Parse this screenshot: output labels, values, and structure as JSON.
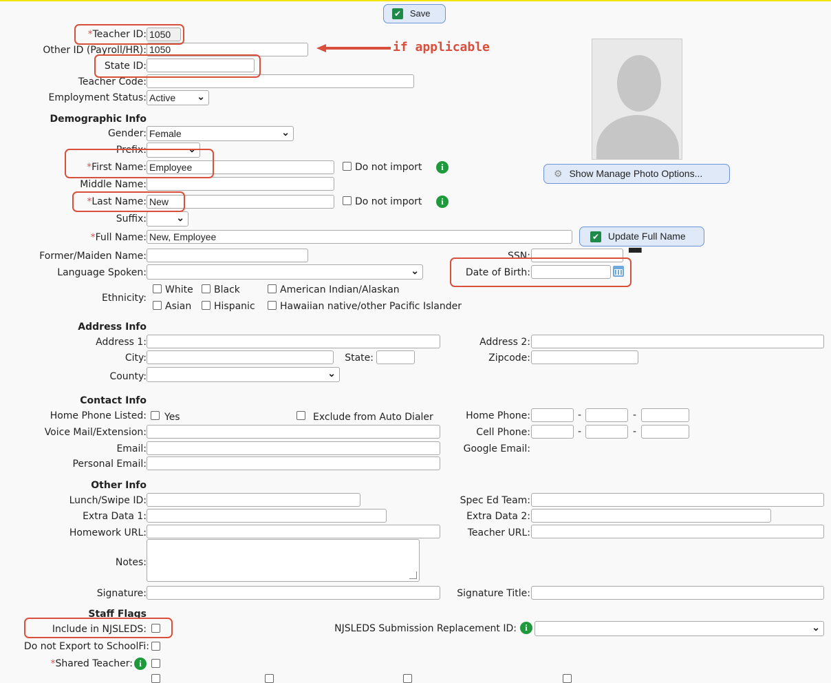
{
  "toolbar": {
    "save_label": "Save"
  },
  "annotation": {
    "note": "if applicable"
  },
  "fields": {
    "teacher_id": {
      "label": "Teacher ID:",
      "value": "1050"
    },
    "other_id": {
      "label": "Other ID (Payroll/HR):",
      "value": "1050"
    },
    "state_id": {
      "label": "State ID:",
      "value": ""
    },
    "teacher_code": {
      "label": "Teacher Code:",
      "value": ""
    },
    "employment_status": {
      "label": "Employment Status:",
      "value": "Active"
    }
  },
  "demographic": {
    "title": "Demographic Info",
    "gender": {
      "label": "Gender:",
      "value": "Female"
    },
    "prefix": {
      "label": "Prefix:",
      "value": ""
    },
    "first_name": {
      "label": "First Name:",
      "value": "Employee"
    },
    "middle_name": {
      "label": "Middle Name:",
      "value": ""
    },
    "last_name": {
      "label": "Last Name:",
      "value": "New"
    },
    "suffix": {
      "label": "Suffix:",
      "value": ""
    },
    "full_name": {
      "label": "Full Name:",
      "value": "New, Employee"
    },
    "former_name": {
      "label": "Former/Maiden Name:",
      "value": ""
    },
    "language": {
      "label": "Language Spoken:",
      "value": ""
    },
    "ssn": {
      "label": "SSN:",
      "value": ""
    },
    "dob": {
      "label": "Date of Birth:",
      "value": ""
    },
    "ethnicity": {
      "label": "Ethnicity:",
      "options": [
        "White",
        "Black",
        "American Indian/Alaskan",
        "Asian",
        "Hispanic",
        "Hawaiian native/other Pacific Islander"
      ]
    },
    "do_not_import": "Do not import",
    "update_full_name": "Update Full Name",
    "show_photo_options": "Show Manage Photo Options..."
  },
  "address": {
    "title": "Address Info",
    "address1": "Address 1:",
    "address2": "Address 2:",
    "city": "City:",
    "state": "State:",
    "zipcode": "Zipcode:",
    "county": "County:"
  },
  "contact": {
    "title": "Contact Info",
    "home_phone_listed": "Home Phone Listed:",
    "yes": "Yes",
    "exclude_dialer": "Exclude from Auto Dialer",
    "home_phone": "Home Phone:",
    "voice_mail": "Voice Mail/Extension:",
    "cell_phone": "Cell Phone:",
    "email": "Email:",
    "google_email": "Google Email:",
    "personal_email": "Personal Email:",
    "dash": "-"
  },
  "other": {
    "title": "Other Info",
    "lunch_id": "Lunch/Swipe ID:",
    "spec_ed": "Spec Ed Team:",
    "extra1": "Extra Data 1:",
    "extra2": "Extra Data 2:",
    "homework_url": "Homework URL:",
    "teacher_url": "Teacher URL:",
    "notes": "Notes:",
    "signature": "Signature:",
    "signature_title": "Signature Title:"
  },
  "flags": {
    "title": "Staff Flags",
    "njsleds": "Include in NJSLEDS:",
    "njsleds_replacement": "NJSLEDS Submission Replacement ID:",
    "schoolfi": "Do not Export to SchoolFi:",
    "shared_teacher": "Shared Teacher:"
  }
}
